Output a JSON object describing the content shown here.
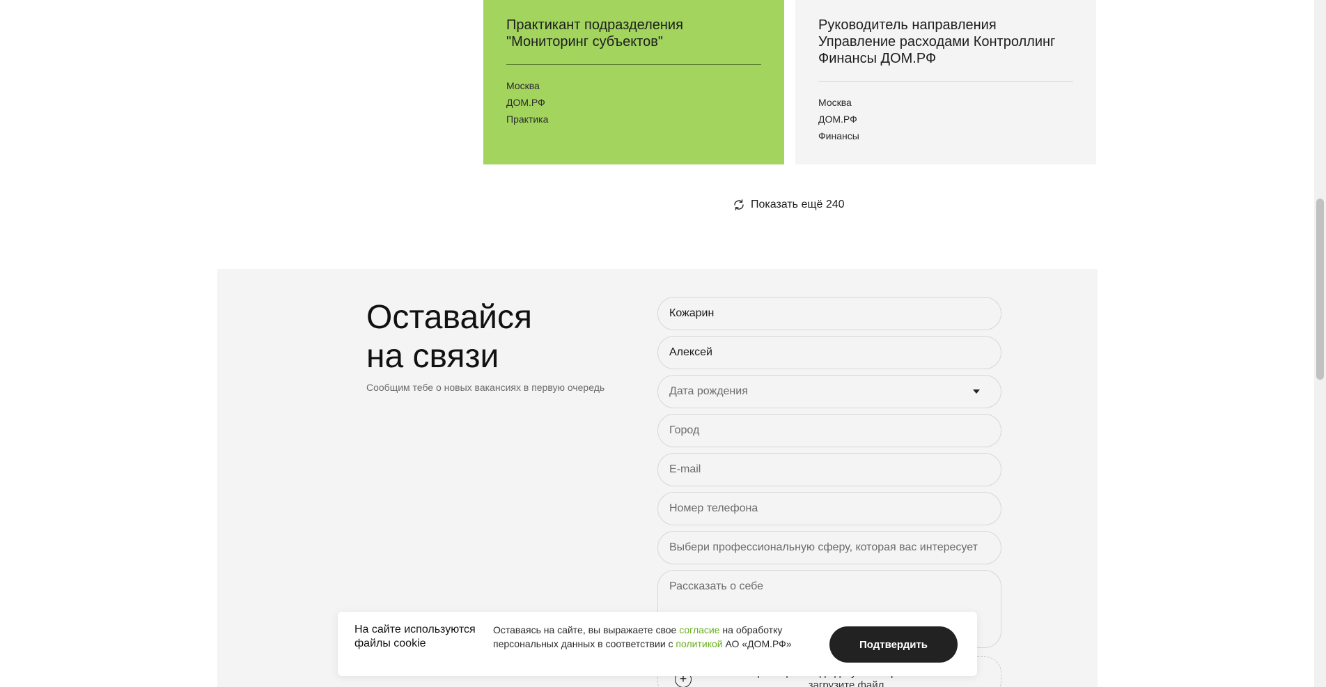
{
  "cards": [
    {
      "title": "Практикант подразделения \"Мониторинг субъектов\"",
      "city": "Москва",
      "company": "ДОМ.РФ",
      "category": "Практика",
      "background": "#a2d45e"
    },
    {
      "title": "Руководитель направления Управление расходами Контроллинг Финансы ДОМ.РФ",
      "city": "Москва",
      "company": "ДОМ.РФ",
      "category": "Финансы",
      "background": "#f4f4f5"
    }
  ],
  "show_more": {
    "label": "Показать ещё 240",
    "icon": "refresh-icon"
  },
  "contact": {
    "title_line1": "Оставайся",
    "title_line2": "на связи",
    "subtitle": "Сообщим тебе о новых вакансиях в первую очередь",
    "fields": {
      "last_name_value": "Кожарин",
      "first_name_value": "Алексей",
      "birth_date_placeholder": "Дата рождения",
      "city_placeholder": "Город",
      "email_placeholder": "E-mail",
      "phone_placeholder": "Номер телефона",
      "sphere_placeholder": "Выбери профессиональную сферу, которая вас интересует",
      "about_placeholder": "Рассказать о себе"
    },
    "upload_text": "Перетащите сюда документ с резюме или загрузите файл",
    "upload_icon": "plus-circle-icon"
  },
  "cookie": {
    "title": "На сайте используются файлы cookie",
    "text_before": "Оставаясь на сайте, вы выражаете свое ",
    "link_consent": "согласие",
    "text_middle": " на обработку персональных данных в соответствии с ",
    "link_policy": "политикой",
    "text_after": " АО «ДОМ.РФ»",
    "confirm_label": "Подтвердить",
    "accent": "#6aad1f"
  }
}
